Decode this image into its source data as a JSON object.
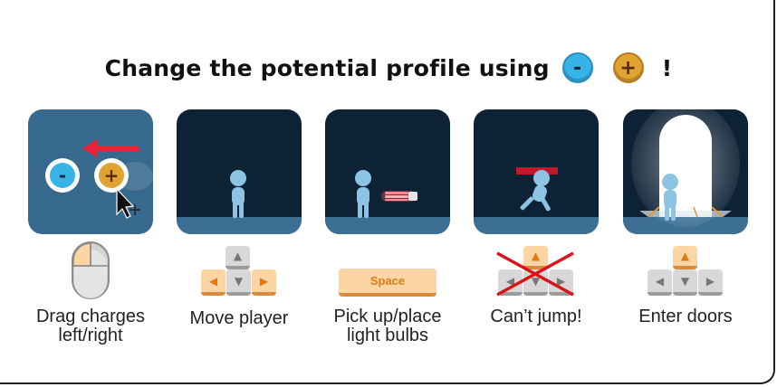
{
  "title": {
    "text": "Change the potential profile using",
    "minus_symbol": "-",
    "plus_symbol": "+",
    "end": "!"
  },
  "steps": [
    {
      "caption_line1": "Drag charges",
      "caption_line2": "left/right",
      "input": "mouse-icon"
    },
    {
      "caption_line1": "Move player",
      "caption_line2": "",
      "input": "arrow-keys-icon"
    },
    {
      "caption_line1": "Pick up/place",
      "caption_line2": "light bulbs",
      "input": "space-key",
      "key_label": "Space"
    },
    {
      "caption_line1": "Can’t jump!",
      "caption_line2": "",
      "input": "crossed-arrow-keys-icon"
    },
    {
      "caption_line1": "Enter doors",
      "caption_line2": "",
      "input": "up-arrow-keys-icon"
    }
  ],
  "colors": {
    "panel_bg": "#0e2236",
    "floor": "#3c6f93",
    "player": "#8fc3e3",
    "accent_orange": "#e07b14",
    "cross_red": "#d9141b"
  }
}
